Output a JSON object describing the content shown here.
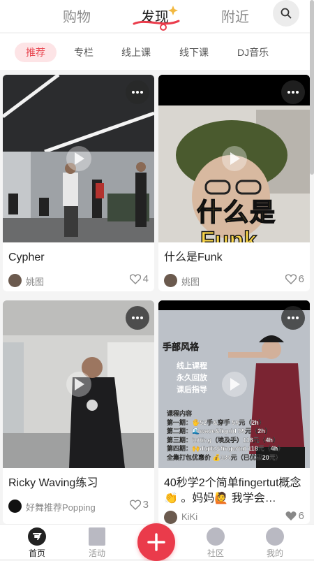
{
  "top_tabs": [
    "购物",
    "发现",
    "附近"
  ],
  "active_top_tab": "发现",
  "sub_tabs": [
    "推荐",
    "专栏",
    "线上课",
    "线下课",
    "DJ音乐"
  ],
  "active_sub_tab": "推荐",
  "cards": [
    {
      "title": "Cypher",
      "author": "姚图",
      "likes": "4"
    },
    {
      "title": "什么是Funk",
      "author": "姚图",
      "likes": "6",
      "overlay_text": [
        "什么是",
        "Funk"
      ]
    },
    {
      "title": "Ricky Waving练习",
      "author": "好舞推荐Popping",
      "likes": "3"
    },
    {
      "title": "40秒学2个简单fingertut概念👏 。妈妈🙋 我学会…",
      "author": "KiKi",
      "likes": "6",
      "poster": {
        "heading": "手部风格",
        "features": [
          "线上课程",
          "永久回放",
          "课后指导"
        ],
        "section": "课程内容",
        "items": [
          "第一期：🖐52手&穿手 59元（2h）",
          "第二期：🌊wave&liquid 59元（2h）",
          "第三期：tutting（埃及手）118元（4h）",
          "第四期：🙌digitz&fingertut 118元（4h）",
          "全集打包优惠价 💰334元（已优惠20元）"
        ]
      }
    }
  ],
  "bottom_nav": {
    "home": "首页",
    "activity": "活动",
    "community": "社区",
    "mine": "我的"
  },
  "colors": {
    "accent": "#ea3b4b",
    "active_chip_bg": "#fde4e6",
    "active_chip_text": "#e8454f"
  }
}
